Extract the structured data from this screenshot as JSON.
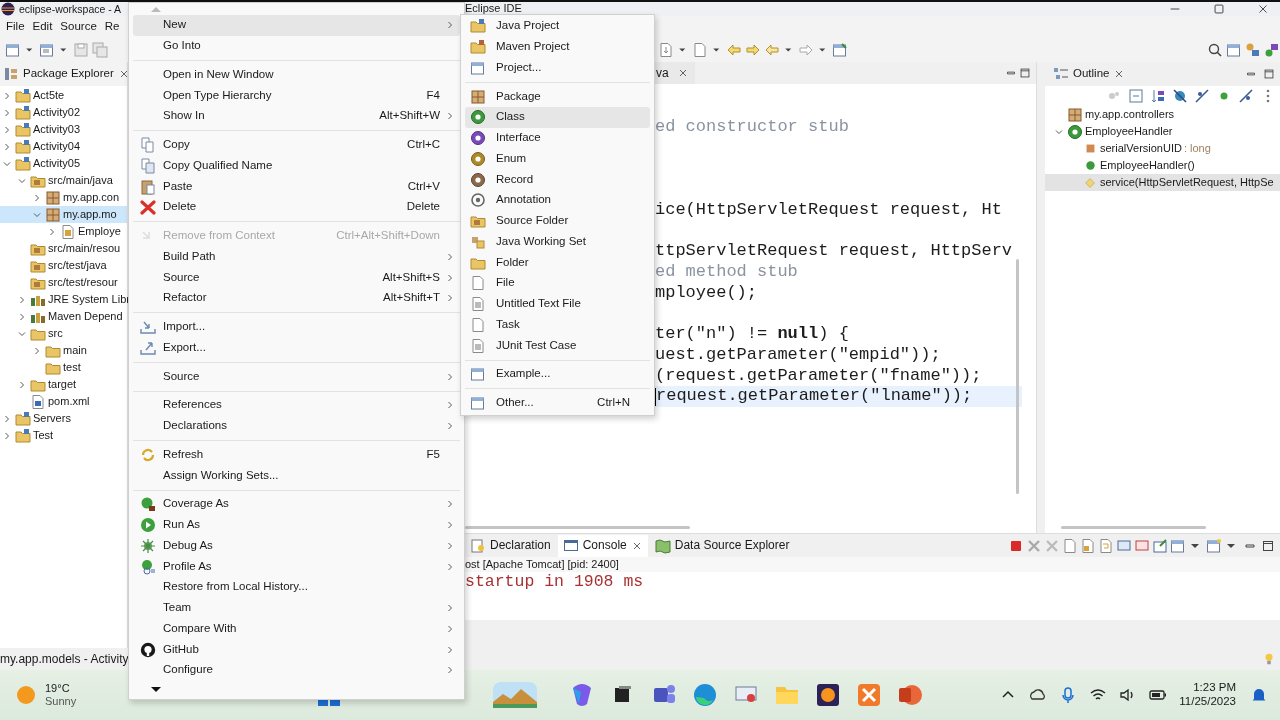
{
  "window": {
    "title_parts": [
      "eclipse-workspace - A",
      "Eclipse IDE"
    ]
  },
  "menu_bar": [
    {
      "label": "File"
    },
    {
      "label": "Edit"
    },
    {
      "label": "Source"
    },
    {
      "label": "Re"
    }
  ],
  "package_explorer": {
    "title": "Package Explorer",
    "tree": [
      {
        "label": "Act5te",
        "kind": "project",
        "expanded": false,
        "selected": false
      },
      {
        "label": "Activity02",
        "kind": "project",
        "expanded": false,
        "selected": false
      },
      {
        "label": "Activity03",
        "kind": "project",
        "expanded": false,
        "selected": false
      },
      {
        "label": "Activity04",
        "kind": "project",
        "expanded": false,
        "selected": false
      },
      {
        "label": "Activity05",
        "kind": "project",
        "expanded": true,
        "selected": false,
        "children": [
          {
            "label": "src/main/java",
            "kind": "source-folder",
            "expanded": true,
            "selected": false,
            "children": [
              {
                "label": "my.app.con",
                "kind": "package",
                "expanded": false,
                "selected": false
              },
              {
                "label": "my.app.mo",
                "kind": "package",
                "expanded": true,
                "selected": true,
                "children": [
                  {
                    "label": "Employe",
                    "kind": "java-file",
                    "expanded": false,
                    "selected": false
                  }
                ]
              }
            ]
          },
          {
            "label": "src/main/resou",
            "kind": "source-folder",
            "selected": false
          },
          {
            "label": "src/test/java",
            "kind": "source-folder",
            "selected": false
          },
          {
            "label": "src/test/resour",
            "kind": "source-folder",
            "selected": false
          },
          {
            "label": "JRE System Libr",
            "kind": "library",
            "expanded": false,
            "selected": false
          },
          {
            "label": "Maven Depend",
            "kind": "library",
            "expanded": false,
            "selected": false
          },
          {
            "label": "src",
            "kind": "folder",
            "expanded": true,
            "selected": false,
            "children": [
              {
                "label": "main",
                "kind": "folder",
                "expanded": false,
                "selected": false
              },
              {
                "label": "test",
                "kind": "folder",
                "selected": false
              }
            ]
          },
          {
            "label": "target",
            "kind": "folder",
            "expanded": false,
            "selected": false
          },
          {
            "label": "pom.xml",
            "kind": "xml-file",
            "selected": false
          }
        ]
      },
      {
        "label": "Servers",
        "kind": "project",
        "expanded": false,
        "selected": false
      },
      {
        "label": "Test",
        "kind": "project",
        "expanded": false,
        "selected": false
      }
    ]
  },
  "editor": {
    "tab": "va",
    "lines": [
      {
        "kind": "blank"
      },
      {
        "kind": "blank"
      },
      {
        "kind": "comment",
        "text": "ed constructor stub",
        "current": false
      },
      {
        "kind": "blank"
      },
      {
        "kind": "blank"
      },
      {
        "kind": "blank"
      },
      {
        "kind": "code",
        "text": "ice(HttpServletRequest request, Ht",
        "current": false
      },
      {
        "kind": "blank"
      },
      {
        "kind": "code",
        "text": "ttpServletRequest request, HttpServ",
        "current": false
      },
      {
        "kind": "comment",
        "text": "ed method stub",
        "current": false
      },
      {
        "kind": "code",
        "text": "mployee();",
        "current": false
      },
      {
        "kind": "blank"
      },
      {
        "kind": "code",
        "text": "ter(\"n\") != **null**) {",
        "current": false
      },
      {
        "kind": "code",
        "text": "uest.getParameter(\"empid\"));",
        "current": false
      },
      {
        "kind": "code",
        "text": "(request.getParameter(\"fname\"));",
        "current": false
      },
      {
        "kind": "code",
        "text": "request.getParameter(\"lname\"));",
        "current": true
      }
    ]
  },
  "outline": {
    "title": "Outline",
    "tree": [
      {
        "label": "my.app.controllers",
        "kind": "package",
        "selected": false
      },
      {
        "label": "EmployeeHandler",
        "kind": "class",
        "expanded": true,
        "selected": false,
        "children": [
          {
            "label": "serialVersionUID",
            "detail": ": long",
            "kind": "field",
            "selected": false
          },
          {
            "label": "EmployeeHandler()",
            "kind": "constructor",
            "selected": false
          },
          {
            "label": "service(HttpServletRequest, HttpSe",
            "kind": "method",
            "selected": true
          }
        ]
      }
    ]
  },
  "bottom_panel": {
    "tabs": [
      {
        "label": "Declaration",
        "kind": "declaration",
        "selected": false
      },
      {
        "label": "Console",
        "kind": "console",
        "selected": true
      },
      {
        "label": "Data Source Explorer",
        "kind": "datasource",
        "selected": false
      }
    ],
    "process": "ost [Apache Tomcat]  [pid: 2400]",
    "output": "startup in 1908 ms"
  },
  "status_bar": "my.app.models - Activity",
  "context_menu": {
    "items": [
      {
        "kind": "plain",
        "label": "New",
        "submenu": true,
        "disabled": false,
        "highlighted": true
      },
      {
        "kind": "plain",
        "label": "Go Into",
        "submenu": false,
        "disabled": false,
        "highlighted": false
      },
      {
        "kind": "separator"
      },
      {
        "kind": "plain",
        "label": "Open in New Window",
        "submenu": false,
        "disabled": false,
        "highlighted": false
      },
      {
        "kind": "plain",
        "label": "Open Type Hierarchy",
        "shortcut": "F4",
        "submenu": false,
        "disabled": false,
        "highlighted": false
      },
      {
        "kind": "plain",
        "label": "Show In",
        "shortcut": "Alt+Shift+W",
        "submenu": true,
        "disabled": false,
        "highlighted": false
      },
      {
        "kind": "separator"
      },
      {
        "kind": "copy",
        "label": "Copy",
        "shortcut": "Ctrl+C",
        "submenu": false,
        "disabled": false,
        "highlighted": false
      },
      {
        "kind": "copy-qualified",
        "label": "Copy Qualified Name",
        "submenu": false,
        "disabled": false,
        "highlighted": false
      },
      {
        "kind": "paste",
        "label": "Paste",
        "shortcut": "Ctrl+V",
        "submenu": false,
        "disabled": false,
        "highlighted": false
      },
      {
        "kind": "delete",
        "label": "Delete",
        "shortcut": "Delete",
        "submenu": false,
        "disabled": false,
        "highlighted": false
      },
      {
        "kind": "separator"
      },
      {
        "kind": "remove",
        "label": "Remove from Context",
        "shortcut": "Ctrl+Alt+Shift+Down",
        "submenu": false,
        "disabled": true,
        "highlighted": false
      },
      {
        "kind": "plain",
        "label": "Build Path",
        "submenu": true,
        "disabled": false,
        "highlighted": false
      },
      {
        "kind": "plain",
        "label": "Source",
        "shortcut": "Alt+Shift+S",
        "submenu": true,
        "disabled": false,
        "highlighted": false
      },
      {
        "kind": "plain",
        "label": "Refactor",
        "shortcut": "Alt+Shift+T",
        "submenu": true,
        "disabled": false,
        "highlighted": false
      },
      {
        "kind": "separator"
      },
      {
        "kind": "import",
        "label": "Import...",
        "submenu": false,
        "disabled": false,
        "highlighted": false
      },
      {
        "kind": "export",
        "label": "Export...",
        "submenu": false,
        "disabled": false,
        "highlighted": false
      },
      {
        "kind": "separator"
      },
      {
        "kind": "plain",
        "label": "Source",
        "submenu": true,
        "disabled": false,
        "highlighted": false
      },
      {
        "kind": "separator"
      },
      {
        "kind": "plain",
        "label": "References",
        "submenu": true,
        "disabled": false,
        "highlighted": false
      },
      {
        "kind": "plain",
        "label": "Declarations",
        "submenu": true,
        "disabled": false,
        "highlighted": false
      },
      {
        "kind": "separator"
      },
      {
        "kind": "refresh",
        "label": "Refresh",
        "shortcut": "F5",
        "submenu": false,
        "disabled": false,
        "highlighted": false
      },
      {
        "kind": "plain",
        "label": "Assign Working Sets...",
        "submenu": false,
        "disabled": false,
        "highlighted": false
      },
      {
        "kind": "separator"
      },
      {
        "kind": "coverage",
        "label": "Coverage As",
        "submenu": true,
        "disabled": false,
        "highlighted": false
      },
      {
        "kind": "run",
        "label": "Run As",
        "submenu": true,
        "disabled": false,
        "highlighted": false
      },
      {
        "kind": "debug",
        "label": "Debug As",
        "submenu": true,
        "disabled": false,
        "highlighted": false
      },
      {
        "kind": "profile",
        "label": "Profile As",
        "submenu": true,
        "disabled": false,
        "highlighted": false
      },
      {
        "kind": "plain",
        "label": "Restore from Local History...",
        "submenu": false,
        "disabled": false,
        "highlighted": false
      },
      {
        "kind": "plain",
        "label": "Team",
        "submenu": true,
        "disabled": false,
        "highlighted": false
      },
      {
        "kind": "plain",
        "label": "Compare With",
        "submenu": true,
        "disabled": false,
        "highlighted": false
      },
      {
        "kind": "github",
        "label": "GitHub",
        "submenu": true,
        "disabled": false,
        "highlighted": false
      },
      {
        "kind": "plain",
        "label": "Configure",
        "submenu": true,
        "disabled": false,
        "highlighted": false
      }
    ]
  },
  "new_submenu": {
    "items": [
      {
        "kind": "java-project",
        "label": "Java Project",
        "highlighted": false
      },
      {
        "kind": "maven-project",
        "label": "Maven Project",
        "highlighted": false
      },
      {
        "kind": "window",
        "label": "Project...",
        "highlighted": false
      },
      {
        "kind": "separator"
      },
      {
        "kind": "package",
        "label": "Package",
        "highlighted": false
      },
      {
        "kind": "class",
        "label": "Class",
        "highlighted": true
      },
      {
        "kind": "interface",
        "label": "Interface",
        "highlighted": false
      },
      {
        "kind": "enum",
        "label": "Enum",
        "highlighted": false
      },
      {
        "kind": "record",
        "label": "Record",
        "highlighted": false
      },
      {
        "kind": "annotation",
        "label": "Annotation",
        "highlighted": false
      },
      {
        "kind": "source-folder",
        "label": "Source Folder",
        "highlighted": false
      },
      {
        "kind": "working-set",
        "label": "Java Working Set",
        "highlighted": false
      },
      {
        "kind": "folder",
        "label": "Folder",
        "highlighted": false
      },
      {
        "kind": "page",
        "label": "File",
        "highlighted": false
      },
      {
        "kind": "text-file",
        "label": "Untitled Text File",
        "highlighted": false
      },
      {
        "kind": "page",
        "label": "Task",
        "highlighted": false
      },
      {
        "kind": "text-file",
        "label": "JUnit Test Case",
        "highlighted": false
      },
      {
        "kind": "separator"
      },
      {
        "kind": "window",
        "label": "Example...",
        "highlighted": false
      },
      {
        "kind": "separator"
      },
      {
        "kind": "window",
        "label": "Other...",
        "shortcut": "Ctrl+N",
        "highlighted": false
      }
    ]
  },
  "taskbar": {
    "temperature": "19°C",
    "condition": "Sunny",
    "time": "1:23 PM",
    "date": "11/25/2023"
  }
}
